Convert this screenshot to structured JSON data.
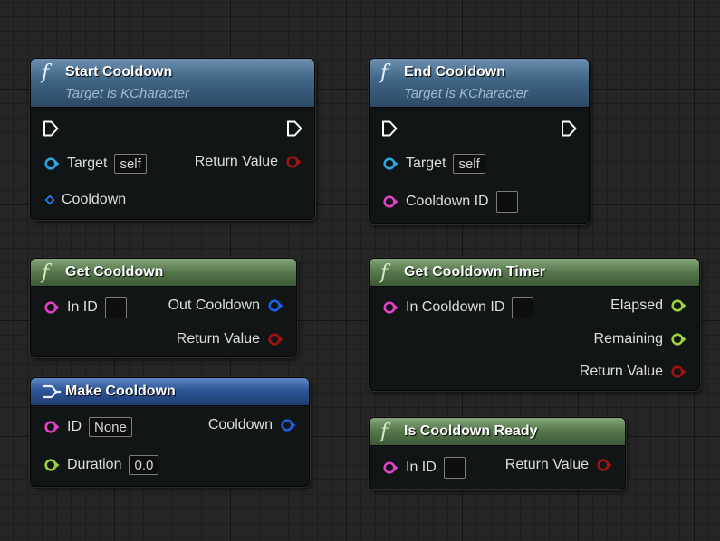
{
  "nodes": {
    "start_cooldown": {
      "title": "Start Cooldown",
      "subtitle": "Target is KCharacter",
      "target_label": "Target",
      "target_value": "self",
      "return_label": "Return Value",
      "cooldown_label": "Cooldown"
    },
    "end_cooldown": {
      "title": "End Cooldown",
      "subtitle": "Target is KCharacter",
      "target_label": "Target",
      "target_value": "self",
      "cooldown_id_label": "Cooldown ID"
    },
    "get_cooldown": {
      "title": "Get Cooldown",
      "in_id_label": "In ID",
      "out_cooldown_label": "Out Cooldown",
      "return_label": "Return Value"
    },
    "get_cooldown_timer": {
      "title": "Get Cooldown Timer",
      "in_cooldown_id_label": "In Cooldown ID",
      "elapsed_label": "Elapsed",
      "remaining_label": "Remaining",
      "return_label": "Return Value"
    },
    "make_cooldown": {
      "title": "Make Cooldown",
      "id_label": "ID",
      "id_value": "None",
      "cooldown_label": "Cooldown",
      "duration_label": "Duration",
      "duration_value": "0.0"
    },
    "is_cooldown_ready": {
      "title": "Is Cooldown Ready",
      "in_id_label": "In ID",
      "return_label": "Return Value"
    }
  },
  "colors": {
    "canvas_bg": "#262626",
    "function_header": "#3f6484",
    "pure_header": "#587a4e",
    "make_header": "#2e5596",
    "pin_object": "#2fa4df",
    "pin_struct": "#e040c8",
    "pin_float": "#9ad43a",
    "pin_blue": "#1d5fdc",
    "pin_return": "#990f0f",
    "pin_exec": "#ffffff"
  },
  "icons": {
    "function": "function-f-icon",
    "make_struct": "make-struct-icon",
    "exec": "exec-pin-icon"
  }
}
